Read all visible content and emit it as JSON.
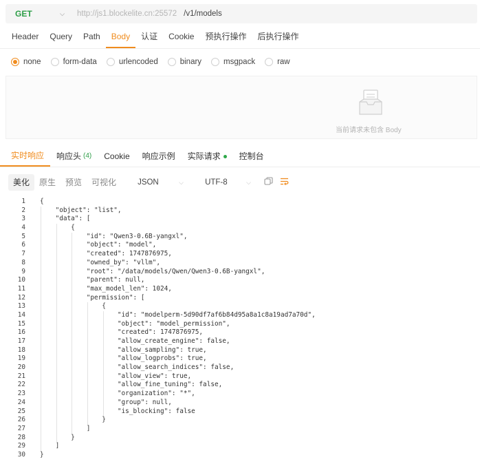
{
  "request": {
    "method": "GET",
    "host": "http://js1.blockelite.cn:25572",
    "path": "/v1/models",
    "tabs": [
      "Header",
      "Query",
      "Path",
      "Body",
      "认证",
      "Cookie",
      "预执行操作",
      "后执行操作"
    ],
    "active_tab": "Body"
  },
  "body_types": {
    "options": [
      "none",
      "form-data",
      "urlencoded",
      "binary",
      "msgpack",
      "raw"
    ],
    "selected": "none"
  },
  "empty_body": {
    "text": "当前请求未包含 Body",
    "icon": "empty-box-icon"
  },
  "response": {
    "tabs": [
      {
        "label": "实时响应"
      },
      {
        "label": "响应头",
        "count": "(4)"
      },
      {
        "label": "Cookie"
      },
      {
        "label": "响应示例"
      },
      {
        "label": "实际请求",
        "status": "green-dot"
      },
      {
        "label": "控制台"
      }
    ],
    "active_tab": "实时响应",
    "view_modes": [
      "美化",
      "原生",
      "预览",
      "可视化"
    ],
    "active_view": "美化",
    "format": "JSON",
    "encoding": "UTF-8",
    "icons": [
      "copy-icon",
      "wrap-icon"
    ]
  },
  "code_lines": [
    "{",
    "    \"object\": \"list\",",
    "    \"data\": [",
    "        {",
    "            \"id\": \"Qwen3-0.6B-yangxl\",",
    "            \"object\": \"model\",",
    "            \"created\": 1747876975,",
    "            \"owned_by\": \"vllm\",",
    "            \"root\": \"/data/models/Qwen/Qwen3-0.6B-yangxl\",",
    "            \"parent\": null,",
    "            \"max_model_len\": 1024,",
    "            \"permission\": [",
    "                {",
    "                    \"id\": \"modelperm-5d90df7af6b84d95a8a1c8a19ad7a70d\",",
    "                    \"object\": \"model_permission\",",
    "                    \"created\": 1747876975,",
    "                    \"allow_create_engine\": false,",
    "                    \"allow_sampling\": true,",
    "                    \"allow_logprobs\": true,",
    "                    \"allow_search_indices\": false,",
    "                    \"allow_view\": true,",
    "                    \"allow_fine_tuning\": false,",
    "                    \"organization\": \"*\",",
    "                    \"group\": null,",
    "                    \"is_blocking\": false",
    "                }",
    "            ]",
    "        }",
    "    ]",
    "}"
  ],
  "colors": {
    "accent": "#f08c1e",
    "method": "#2e9e48",
    "line_number": "#444444"
  }
}
